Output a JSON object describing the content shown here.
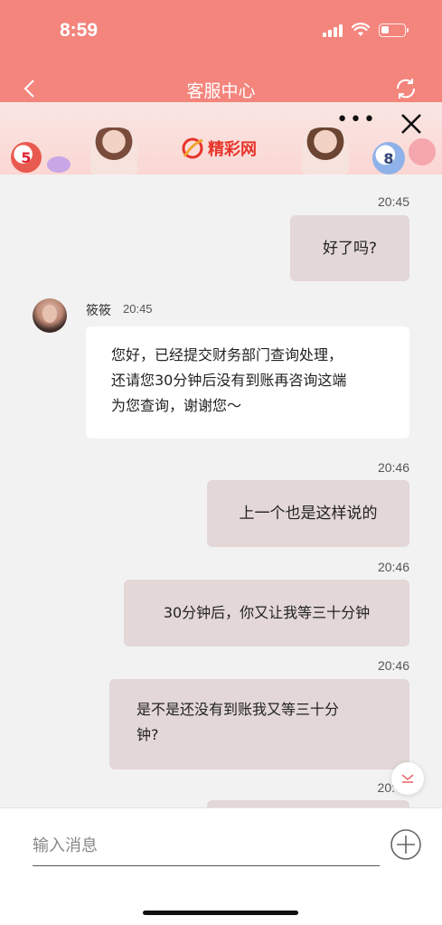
{
  "status_bar": {
    "time": "8:59",
    "battery_level": 0.35
  },
  "nav": {
    "title": "客服中心",
    "back_icon": "chevron-left-icon",
    "refresh_icon": "refresh-icon"
  },
  "banner": {
    "logo_text": "精彩网",
    "ball_left": "5",
    "ball_right": "8",
    "more_icon": "more-dots-icon",
    "close_icon": "close-icon"
  },
  "messages": [
    {
      "time": "20:45",
      "direction": "out",
      "text": "好了吗?"
    },
    {
      "direction": "in",
      "sender": "筱筱",
      "time": "20:45",
      "lines": [
        "您好，已经提交财务部门查询处理，",
        "还请您30分钟后没有到账再咨询这端",
        "为您查询，谢谢您～"
      ]
    },
    {
      "time": "20:46",
      "direction": "out",
      "text": "上一个也是这样说的"
    },
    {
      "time": "20:46",
      "direction": "out",
      "text": "30分钟后，你又让我等三十分钟"
    },
    {
      "time": "20:46",
      "direction": "out",
      "lines": [
        "是不是还没有到账我又等三十分",
        "钟?"
      ]
    },
    {
      "time": "20:",
      "direction": "out",
      "text": ""
    }
  ],
  "input": {
    "placeholder": "输入消息",
    "value": "",
    "add_icon": "plus-circle-icon"
  },
  "colors": {
    "header": "#f3857d",
    "bubble_out": "#e3d7d7",
    "bubble_in": "#ffffff",
    "chat_bg": "#f2f2f2"
  }
}
